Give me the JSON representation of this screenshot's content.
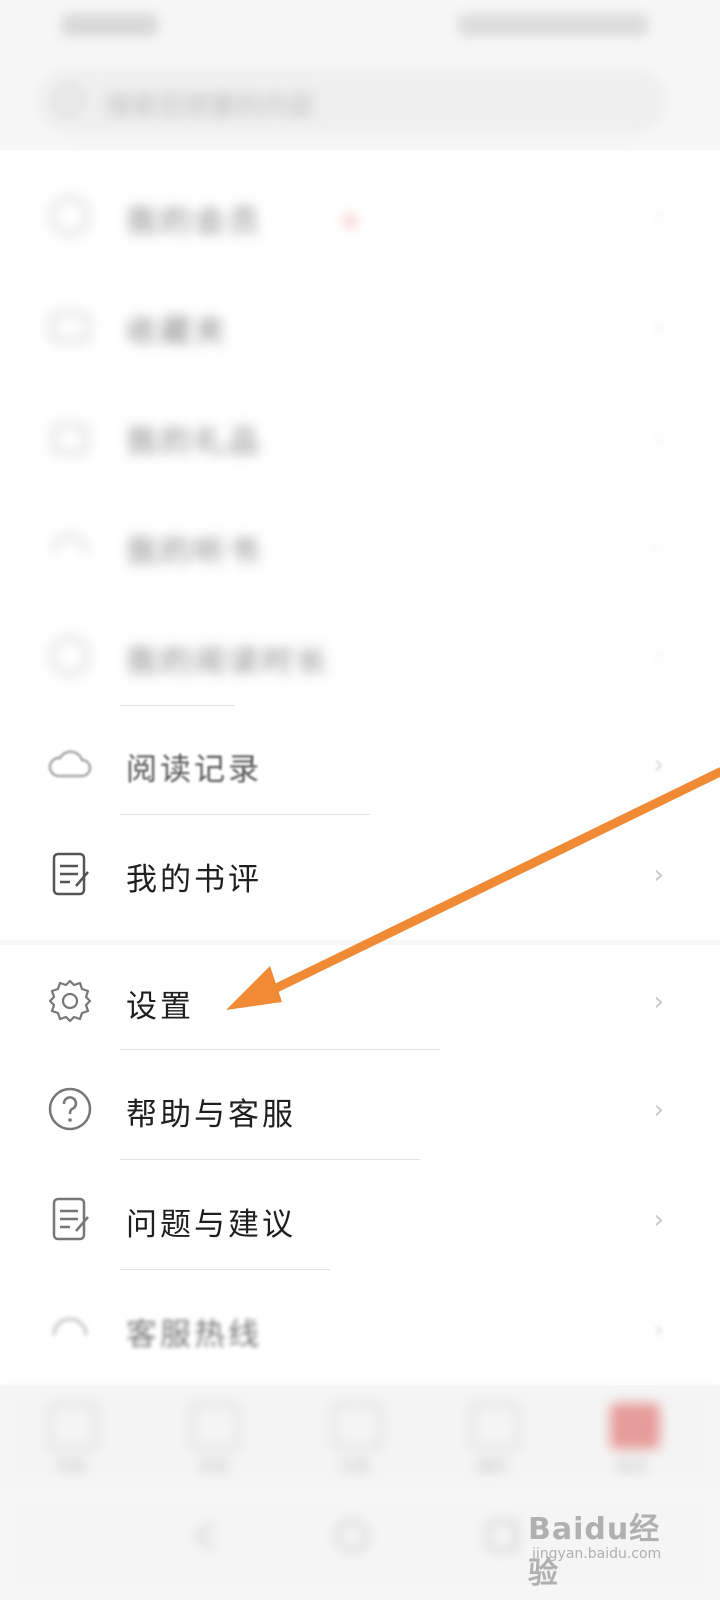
{
  "search": {
    "placeholder": "搜索您想要的内容"
  },
  "menu": {
    "blurred_items": [
      {
        "label": "我的会员",
        "has_badge": true,
        "icon": "crown-icon"
      },
      {
        "label": "收藏夹",
        "icon": "folder-icon"
      },
      {
        "label": "我的礼品",
        "icon": "gift-icon"
      },
      {
        "label": "我的听书",
        "icon": "headphones-icon"
      },
      {
        "label": "我的阅读时长",
        "value": "",
        "icon": "clock-icon"
      }
    ],
    "reading_record": {
      "label": "阅读记录",
      "icon": "cloud-icon"
    },
    "my_review": {
      "label": "我的书评",
      "icon": "note-icon"
    },
    "settings": {
      "label": "设置",
      "icon": "gear-icon"
    },
    "help": {
      "label": "帮助与客服",
      "icon": "question-circle-icon"
    },
    "feedback": {
      "label": "问题与建议",
      "icon": "note-edit-icon"
    },
    "hotline": {
      "label": "客服热线",
      "icon": "headset-icon"
    }
  },
  "tabs": [
    {
      "label": "书架"
    },
    {
      "label": "书城"
    },
    {
      "label": "分类"
    },
    {
      "label": "福利"
    },
    {
      "label": "我的",
      "active": true
    }
  ],
  "watermark": {
    "main": "Baidu经验",
    "sub": "jingyan.baidu.com"
  },
  "colors": {
    "arrow": "#f08a35",
    "accent": "#d9534f"
  }
}
